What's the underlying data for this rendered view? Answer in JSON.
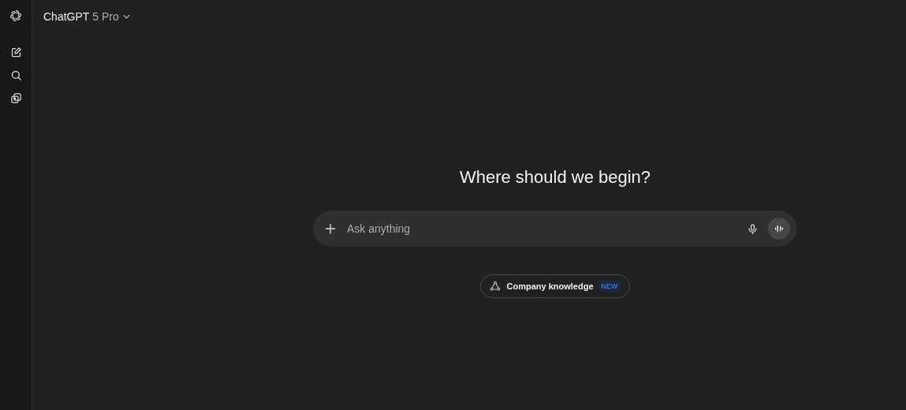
{
  "header": {
    "model_name": "ChatGPT",
    "model_version": "5 Pro"
  },
  "heading": "Where should we begin?",
  "composer": {
    "placeholder": "Ask anything"
  },
  "chip": {
    "label": "Company knowledge",
    "badge": "NEW"
  }
}
